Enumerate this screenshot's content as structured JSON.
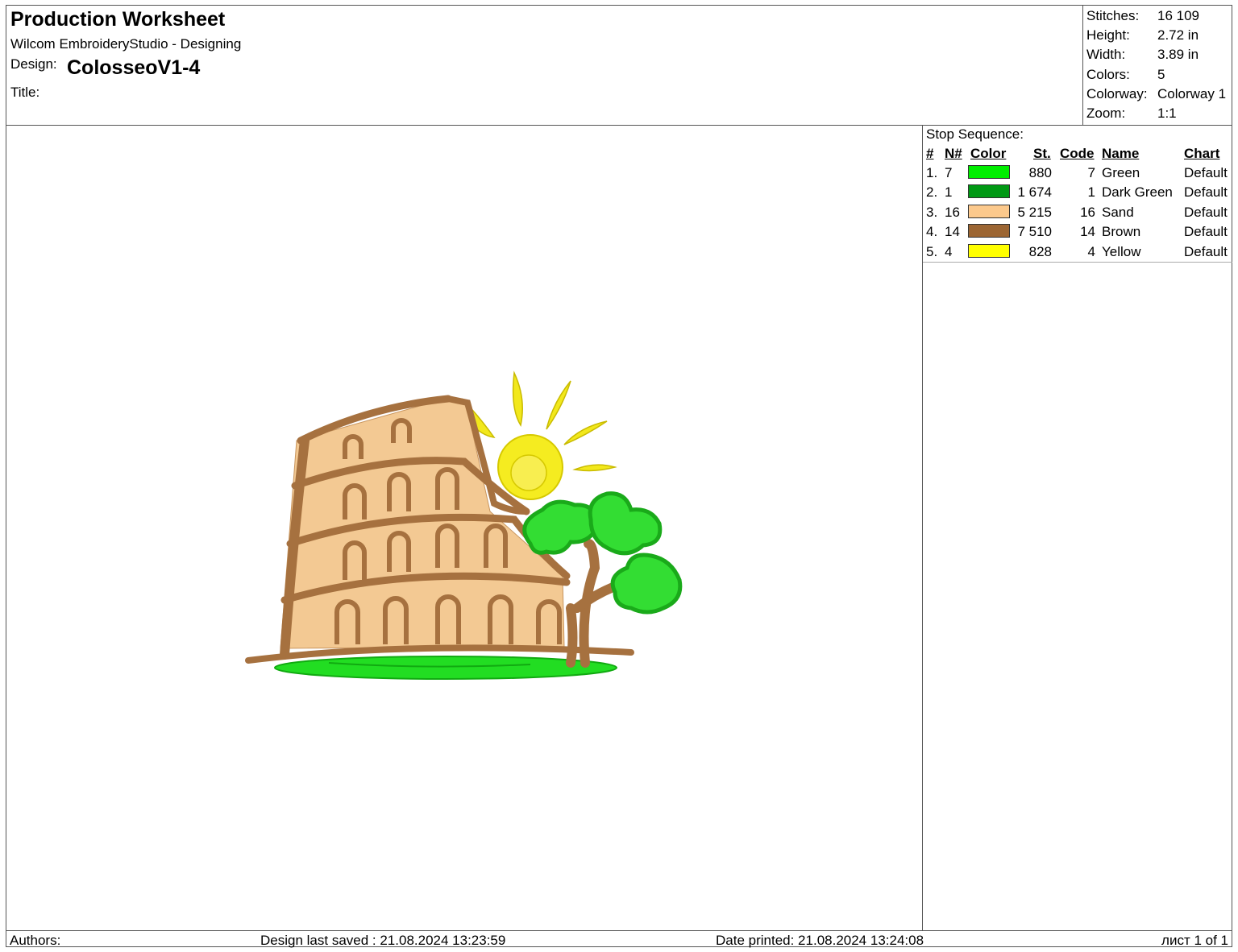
{
  "header": {
    "title": "Production Worksheet",
    "software": "Wilcom EmbroideryStudio - Designing",
    "design_label": "Design:",
    "design_name": "ColosseoV1-4",
    "title_label": "Title:"
  },
  "stats": [
    {
      "label": "Stitches:",
      "value": "16 109"
    },
    {
      "label": "Height:",
      "value": "2.72 in"
    },
    {
      "label": "Width:",
      "value": "3.89 in"
    },
    {
      "label": "Colors:",
      "value": "5"
    },
    {
      "label": "Colorway:",
      "value": "Colorway 1"
    },
    {
      "label": "Zoom:",
      "value": "1:1"
    }
  ],
  "sequence": {
    "title": "Stop Sequence:",
    "headers": {
      "num": "#",
      "n": "N#",
      "color": "Color",
      "st": "St.",
      "code": "Code",
      "name": "Name",
      "chart": "Chart"
    },
    "rows": [
      {
        "num": "1.",
        "n": "7",
        "color": "#00ee00",
        "st": "880",
        "code": "7",
        "name": "Green",
        "chart": "Default"
      },
      {
        "num": "2.",
        "n": "1",
        "color": "#009914",
        "st": "1 674",
        "code": "1",
        "name": "Dark Green",
        "chart": "Default"
      },
      {
        "num": "3.",
        "n": "16",
        "color": "#fcc98c",
        "st": "5 215",
        "code": "16",
        "name": "Sand",
        "chart": "Default"
      },
      {
        "num": "4.",
        "n": "14",
        "color": "#9c6633",
        "st": "7 510",
        "code": "14",
        "name": "Brown",
        "chart": "Default"
      },
      {
        "num": "5.",
        "n": "4",
        "color": "#ffff00",
        "st": "828",
        "code": "4",
        "name": "Yellow",
        "chart": "Default"
      }
    ]
  },
  "footer": {
    "authors": "Authors:",
    "saved": "Design last saved : 21.08.2024 13:23:59",
    "printed": "Date printed: 21.08.2024 13:24:08",
    "page": "лист 1 of 1"
  }
}
